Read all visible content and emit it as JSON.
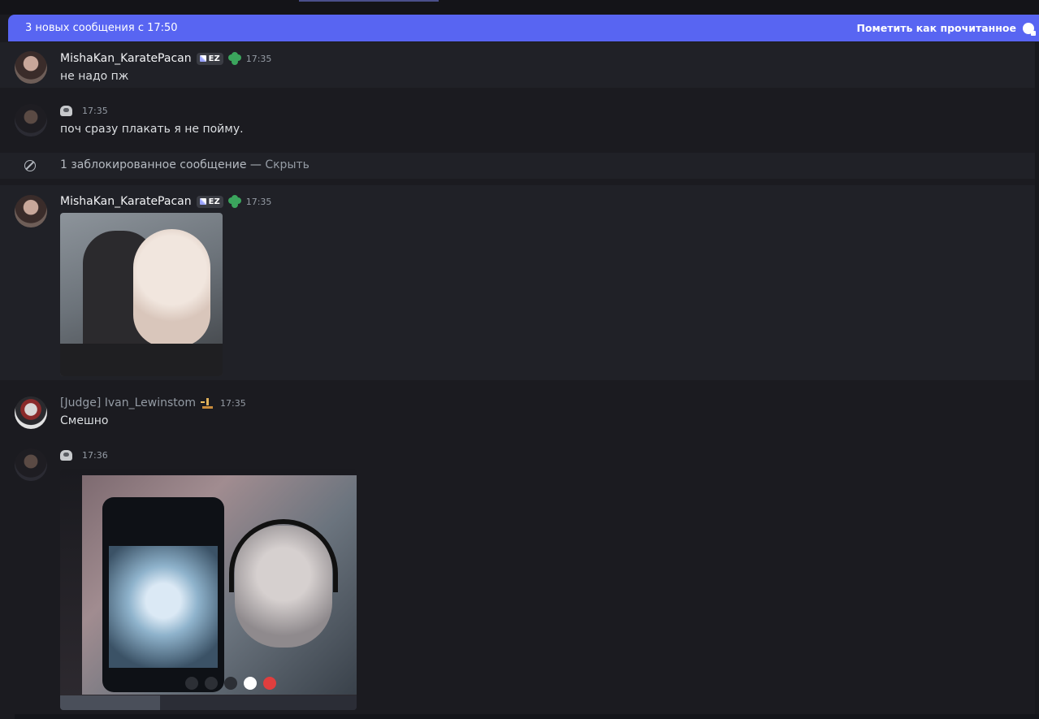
{
  "banner": {
    "text": "3 новых сообщения с 17:50",
    "mark_read": "Пометить как прочитанное"
  },
  "messages": [
    {
      "author": "MishaKan_KaratePacan",
      "tag": "EZ",
      "time": "17:35",
      "text": "не надо пж"
    },
    {
      "author": "",
      "time": "17:35",
      "text": "поч сразу плакать я не пойму."
    },
    {
      "blocked_text": "1 заблокированное сообщение — ",
      "hide": "Скрыть"
    },
    {
      "author": "MishaKan_KaratePacan",
      "tag": "EZ",
      "time": "17:35",
      "attachment": "gif-hamster"
    },
    {
      "author": "[Judge] Ivan_Lewinstom",
      "time": "17:35",
      "text": "Смешно"
    },
    {
      "author": "",
      "time": "17:36",
      "attachment": "gif-videocall"
    }
  ],
  "colors": {
    "accent": "#5865f2",
    "background": "#1b1b20",
    "highlight_row": "#202127",
    "danger": "#e03e3e"
  }
}
